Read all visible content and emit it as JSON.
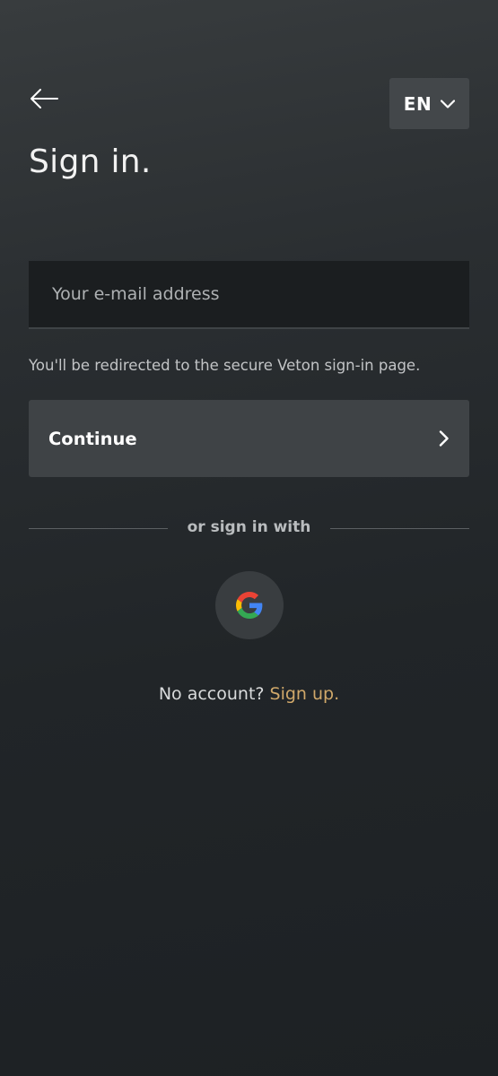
{
  "header": {
    "back_icon": "arrow-left-icon",
    "language": {
      "label": "EN",
      "icon": "chevron-down-icon"
    }
  },
  "title": "Sign in.",
  "email": {
    "placeholder": "Your e-mail address",
    "value": ""
  },
  "redirect_note": "You'll be redirected to the secure Veton sign-in page.",
  "continue_button": {
    "label": "Continue",
    "icon": "chevron-right-icon"
  },
  "divider_text": "or sign in with",
  "social": {
    "google_icon": "google-icon"
  },
  "signup": {
    "prompt": "No account?",
    "link_label": "Sign up",
    "suffix": "."
  },
  "colors": {
    "background": "#212528",
    "panel": "#3f4346",
    "input_background": "#1b1e20",
    "accent_link": "#d0a86a"
  }
}
